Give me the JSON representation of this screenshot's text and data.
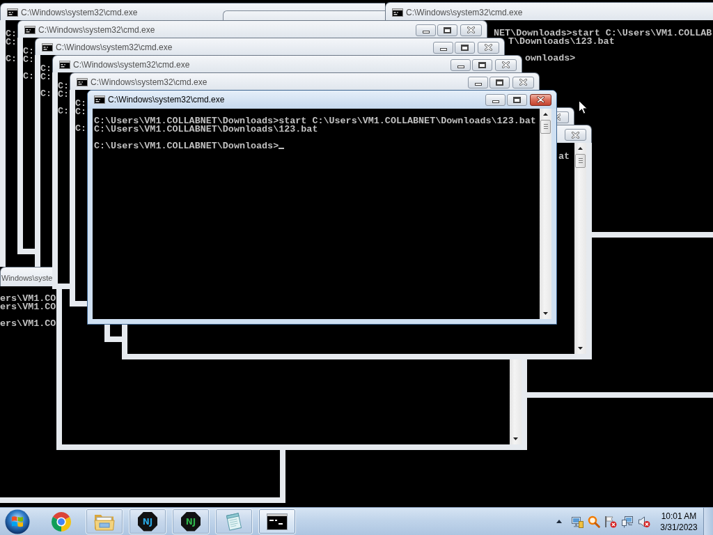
{
  "desktop": {
    "windows": [
      {
        "title": "C:\\Windows\\system32\\cmd.exe",
        "active": false,
        "blocks": [
          [
            "C:",
            "C:"
          ],
          [
            "C:"
          ]
        ]
      },
      {
        "title": "C:\\Windows\\system32\\cmd.exe",
        "active": false,
        "blocks": [
          [
            "NET\\Downloads>start C:\\Users\\VM1.COLLAB",
            "T\\Downloads\\123.bat"
          ],
          [
            "ownloads>"
          ]
        ]
      },
      {
        "title": "Windows\\syste",
        "active": false,
        "blocks": [
          [
            "ers\\VM1.CO",
            "ers\\VM1.CO"
          ],
          [
            "ers\\VM1.CO"
          ]
        ]
      },
      {
        "title": "C:\\Windows\\system32\\cmd.exe",
        "active": false,
        "blocks": [
          [
            "C:",
            "C:"
          ],
          [
            "C:"
          ]
        ]
      },
      {
        "title": "C:\\Windows\\system32\\cmd.exe",
        "active": false,
        "blocks": [
          [
            "C:",
            "C:"
          ],
          [
            "C:"
          ]
        ]
      },
      {
        "title": "C:\\Windows\\system32\\cmd.exe",
        "active": false,
        "blocks": [
          [
            "C:",
            "C:"
          ],
          [
            "C:"
          ]
        ]
      },
      {
        "title": "C:\\Windows\\system32\\cmd.exe",
        "active": false,
        "blocks": [
          [
            "C:",
            "C:"
          ],
          [
            "C:"
          ]
        ]
      },
      {
        "active": false
      },
      {
        "active": false,
        "blocks": [
          [
            "at"
          ]
        ]
      },
      {
        "title": "C:\\Windows\\system32\\cmd.exe",
        "active": true,
        "blocks": [
          [
            "C:\\Users\\VM1.COLLABNET\\Downloads>start C:\\Users\\VM1.COLLABNET\\Downloads\\123.bat",
            "C:\\Users\\VM1.COLLABNET\\Downloads\\123.bat"
          ],
          [
            "C:\\Users\\VM1.COLLABNET\\Downloads>"
          ]
        ]
      }
    ]
  },
  "taskbar": {
    "apps": [
      {
        "kind": "browser",
        "running": false,
        "selected": false
      },
      {
        "kind": "folder",
        "running": true,
        "selected": false
      },
      {
        "kind": "logo",
        "label": "NJ",
        "color": "#2aa6e0",
        "running": true,
        "selected": false
      },
      {
        "kind": "logo",
        "label": "NJ",
        "color": "#2fb34a",
        "running": true,
        "selected": false
      },
      {
        "kind": "notepad",
        "running": true,
        "selected": false
      },
      {
        "kind": "console",
        "running": true,
        "selected": true
      }
    ],
    "clock": {
      "time": "10:01 AM",
      "date": "3/31/2023"
    }
  }
}
